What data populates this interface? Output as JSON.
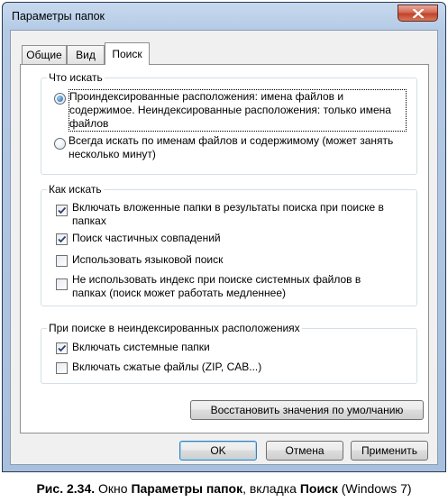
{
  "window": {
    "title": "Параметры папок"
  },
  "tabs": [
    {
      "label": "Общие",
      "active": false
    },
    {
      "label": "Вид",
      "active": false
    },
    {
      "label": "Поиск",
      "active": true
    }
  ],
  "what_to_search": {
    "legend": "Что искать",
    "options": [
      {
        "text": "Проиндексированные расположения: имена файлов и содержимое. Неиндексированные расположения: только имена файлов",
        "selected": true
      },
      {
        "text": "Всегда искать по именам файлов и содержимому (может занять несколько минут)",
        "selected": false
      }
    ]
  },
  "how_to_search": {
    "legend": "Как искать",
    "options": [
      {
        "text": "Включать вложенные папки в результаты поиска при поиске в папках",
        "checked": true
      },
      {
        "text": "Поиск частичных совпадений",
        "checked": true
      },
      {
        "text": "Использовать языковой поиск",
        "checked": false
      },
      {
        "text": "Не использовать индекс при поиске системных файлов в папках (поиск может работать медленнее)",
        "checked": false
      }
    ]
  },
  "non_indexed": {
    "legend": "При поиске в неиндексированных расположениях",
    "options": [
      {
        "text": "Включать системные папки",
        "checked": true
      },
      {
        "text": "Включать сжатые файлы (ZIP, CAB...)",
        "checked": false
      }
    ]
  },
  "buttons": {
    "restore_defaults": "Восстановить значения по умолчанию",
    "ok": "OK",
    "cancel": "Отмена",
    "apply": "Применить"
  },
  "caption": {
    "prefix": "Рис. 2.34.",
    "t1": " Окно ",
    "b1": "Параметры папок",
    "t2": ", вкладка ",
    "b2": "Поиск",
    "t3": " (Windows 7)"
  },
  "icons": {
    "close": "close-icon",
    "check": "checkmark-icon",
    "radio": "radio-dot-icon"
  }
}
